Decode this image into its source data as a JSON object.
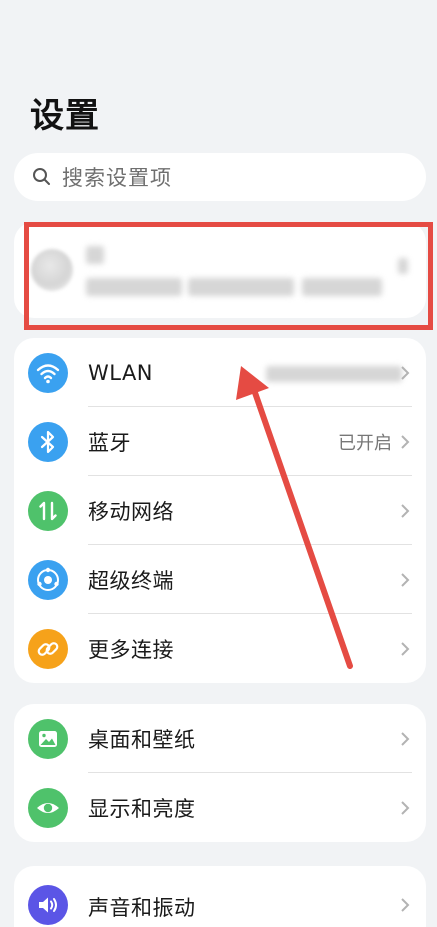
{
  "header": {
    "title": "设置"
  },
  "search": {
    "placeholder": "搜索设置项",
    "icon": "search-icon"
  },
  "account": {
    "avatar": "avatar"
  },
  "groups": {
    "connectivity": [
      {
        "label": "WLAN",
        "icon": "wifi-icon",
        "color": "#3aa1f0",
        "value": ""
      },
      {
        "label": "蓝牙",
        "icon": "bluetooth-icon",
        "color": "#3aa1f0",
        "value": "已开启"
      },
      {
        "label": "移动网络",
        "icon": "mobile-network-icon",
        "color": "#4fc26b",
        "value": ""
      },
      {
        "label": "超级终端",
        "icon": "super-device-icon",
        "color": "#3aa1f0",
        "value": ""
      },
      {
        "label": "更多连接",
        "icon": "link-icon",
        "color": "#f6a21a",
        "value": ""
      }
    ],
    "display": [
      {
        "label": "桌面和壁纸",
        "icon": "wallpaper-icon",
        "color": "#4fc26b"
      },
      {
        "label": "显示和亮度",
        "icon": "eye-icon",
        "color": "#4fc26b"
      }
    ],
    "sound": [
      {
        "label": "声音和振动",
        "icon": "speaker-icon",
        "color": "#5b55e6"
      }
    ]
  },
  "annotation": {
    "frame_color": "#e54b43",
    "arrow_color": "#e54b43"
  }
}
